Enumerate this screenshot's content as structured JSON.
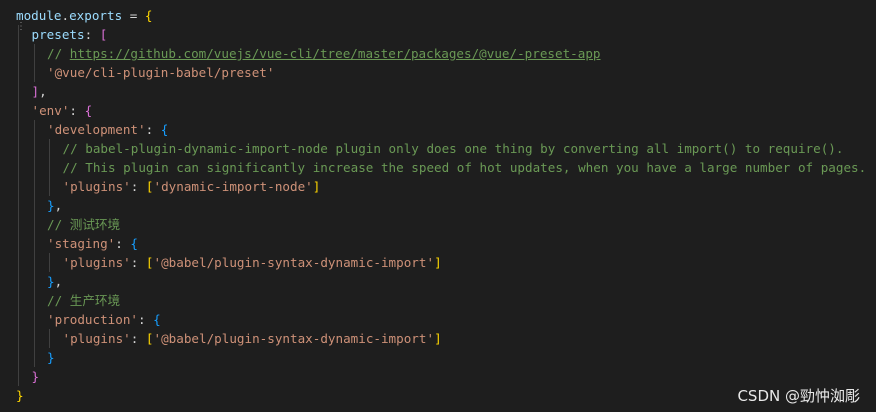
{
  "editor": {
    "lines": [
      {
        "indent": 0,
        "tokens": [
          {
            "t": "module",
            "c": "ident"
          },
          {
            "t": ".",
            "c": "plain"
          },
          {
            "t": "exports",
            "c": "ident"
          },
          {
            "t": " = ",
            "c": "plain"
          },
          {
            "t": "{",
            "c": "bracket-1"
          }
        ]
      },
      {
        "indent": 1,
        "tokens": [
          {
            "t": "presets",
            "c": "ident"
          },
          {
            "t": ": ",
            "c": "plain"
          },
          {
            "t": "[",
            "c": "bracket-2"
          }
        ]
      },
      {
        "indent": 2,
        "tokens": [
          {
            "t": "// ",
            "c": "comment"
          },
          {
            "t": "https://github.com/vuejs/vue-cli/tree/master/packages/@vue/-preset-app",
            "c": "link"
          }
        ]
      },
      {
        "indent": 2,
        "tokens": [
          {
            "t": "'@vue/cli-plugin-babel/preset'",
            "c": "string"
          }
        ]
      },
      {
        "indent": 1,
        "tokens": [
          {
            "t": "]",
            "c": "bracket-2"
          },
          {
            "t": ",",
            "c": "plain"
          }
        ]
      },
      {
        "indent": 1,
        "tokens": [
          {
            "t": "'env'",
            "c": "string"
          },
          {
            "t": ": ",
            "c": "plain"
          },
          {
            "t": "{",
            "c": "bracket-2"
          }
        ]
      },
      {
        "indent": 2,
        "tokens": [
          {
            "t": "'development'",
            "c": "string"
          },
          {
            "t": ": ",
            "c": "plain"
          },
          {
            "t": "{",
            "c": "bracket-3"
          }
        ]
      },
      {
        "indent": 3,
        "tokens": [
          {
            "t": "// babel-plugin-dynamic-import-node plugin only does one thing by converting all import() to require().",
            "c": "comment"
          }
        ]
      },
      {
        "indent": 3,
        "tokens": [
          {
            "t": "// This plugin can significantly increase the speed of hot updates, when you have a large number of pages.",
            "c": "comment"
          }
        ]
      },
      {
        "indent": 3,
        "tokens": [
          {
            "t": "'plugins'",
            "c": "string"
          },
          {
            "t": ": ",
            "c": "plain"
          },
          {
            "t": "[",
            "c": "bracket-1"
          },
          {
            "t": "'dynamic-import-node'",
            "c": "string"
          },
          {
            "t": "]",
            "c": "bracket-1"
          }
        ]
      },
      {
        "indent": 2,
        "tokens": [
          {
            "t": "}",
            "c": "bracket-3"
          },
          {
            "t": ",",
            "c": "plain"
          }
        ]
      },
      {
        "indent": 2,
        "tokens": [
          {
            "t": "// 测试环境",
            "c": "comment"
          }
        ]
      },
      {
        "indent": 2,
        "tokens": [
          {
            "t": "'staging'",
            "c": "string"
          },
          {
            "t": ": ",
            "c": "plain"
          },
          {
            "t": "{",
            "c": "bracket-3"
          }
        ]
      },
      {
        "indent": 3,
        "tokens": [
          {
            "t": "'plugins'",
            "c": "string"
          },
          {
            "t": ": ",
            "c": "plain"
          },
          {
            "t": "[",
            "c": "bracket-1"
          },
          {
            "t": "'@babel/plugin-syntax-dynamic-import'",
            "c": "string"
          },
          {
            "t": "]",
            "c": "bracket-1"
          }
        ]
      },
      {
        "indent": 2,
        "tokens": [
          {
            "t": "}",
            "c": "bracket-3"
          },
          {
            "t": ",",
            "c": "plain"
          }
        ]
      },
      {
        "indent": 2,
        "tokens": [
          {
            "t": "// 生产环境",
            "c": "comment"
          }
        ]
      },
      {
        "indent": 2,
        "tokens": [
          {
            "t": "'production'",
            "c": "string"
          },
          {
            "t": ": ",
            "c": "plain"
          },
          {
            "t": "{",
            "c": "bracket-3"
          }
        ]
      },
      {
        "indent": 3,
        "tokens": [
          {
            "t": "'plugins'",
            "c": "string"
          },
          {
            "t": ": ",
            "c": "plain"
          },
          {
            "t": "[",
            "c": "bracket-1"
          },
          {
            "t": "'@babel/plugin-syntax-dynamic-import'",
            "c": "string"
          },
          {
            "t": "]",
            "c": "bracket-1"
          }
        ]
      },
      {
        "indent": 2,
        "tokens": [
          {
            "t": "}",
            "c": "bracket-3"
          }
        ]
      },
      {
        "indent": 1,
        "tokens": [
          {
            "t": "}",
            "c": "bracket-2"
          }
        ]
      },
      {
        "indent": 0,
        "tokens": [
          {
            "t": "}",
            "c": "bracket-1"
          }
        ]
      }
    ]
  },
  "watermark": {
    "text": "CSDN @勁忡洳彫"
  },
  "colors": {
    "background": "#1e1e1e",
    "identifier": "#9cdcfe",
    "string": "#ce9178",
    "comment": "#6a9955",
    "bracket_level_1": "#ffd700",
    "bracket_level_2": "#da70d6",
    "bracket_level_3": "#179fff"
  }
}
